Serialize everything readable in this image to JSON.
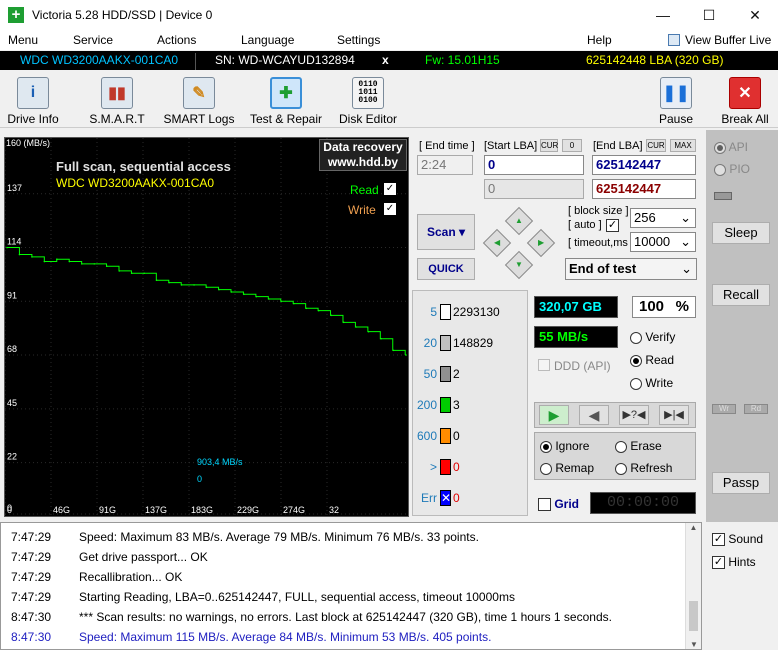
{
  "title": "Victoria 5.28 HDD/SSD | Device 0",
  "window_controls": {
    "minimize": "—",
    "maximize": "☐",
    "close": "✕"
  },
  "menu": [
    "Menu",
    "Service",
    "Actions",
    "Language",
    "Settings",
    "Help"
  ],
  "view_buffer": "View Buffer Live",
  "info": {
    "model": "WDC WD3200AAKX-001CA0",
    "serial": "SN: WD-WCAYUD132894",
    "close": "x",
    "fw": "Fw: 15.01H15",
    "lba": "625142448 LBA (320 GB)"
  },
  "toolbar": {
    "drive_info": "Drive Info",
    "smart": "S.M.A.R.T",
    "smart_logs": "SMART Logs",
    "test_repair": "Test & Repair",
    "disk_editor": "Disk Editor",
    "pause": "Pause",
    "break_all": "Break All"
  },
  "graph": {
    "ylabel": "160 (MB/s)",
    "yticks": [
      "137",
      "114",
      "91",
      "68",
      "45",
      "22",
      "0"
    ],
    "xticks": [
      "0",
      "46G",
      "91G",
      "137G",
      "183G",
      "229G",
      "274G",
      "32"
    ],
    "title": "Full scan, sequential access",
    "model": "WDC WD3200AAKX-001CA0",
    "read": "Read",
    "write": "Write",
    "speed_label": "903,4 MB/s",
    "speed_zero": "0",
    "dr_line1": "Data recovery",
    "dr_line2": "www.hdd.by"
  },
  "chart_data": {
    "type": "line",
    "ylabel": "(MB/s)",
    "ylim": [
      0,
      160
    ],
    "xtick_labels": [
      "0",
      "46G",
      "91G",
      "137G",
      "183G",
      "229G",
      "274G",
      "32"
    ],
    "series": [
      {
        "name": "Read",
        "x": [
          0,
          10,
          20,
          30,
          40,
          50,
          60,
          70,
          80,
          90,
          100,
          110,
          120,
          130,
          140,
          150,
          160,
          170,
          180,
          190,
          200,
          210,
          220,
          230,
          240,
          250,
          260,
          270,
          280,
          290,
          300,
          310,
          320
        ],
        "values": [
          114,
          111,
          110,
          108,
          109,
          108,
          107,
          107,
          106,
          104,
          103,
          103,
          100,
          99,
          98,
          98,
          97,
          96,
          95,
          94,
          93,
          92,
          91,
          90,
          88,
          87,
          85,
          82,
          80,
          78,
          75,
          70,
          68
        ]
      }
    ]
  },
  "ctrl": {
    "end_time_label": "[ End time ]",
    "end_time": "2:24",
    "start_lba_label": "[Start LBA]",
    "cur": "CUR",
    "zero_btn": "0",
    "end_lba_label": "[End LBA]",
    "max": "MAX",
    "start_lba": "0",
    "end_lba": "625142447",
    "cur_lba": "0",
    "cur_end": "625142447",
    "scan": "Scan",
    "quick": "QUICK",
    "block_size_label": "[ block size ]",
    "auto_label": "[ auto ]",
    "block_size": "256",
    "timeout_label": "[ timeout,ms ]",
    "timeout": "10000",
    "end_of_test": "End of test"
  },
  "counts": [
    {
      "label": "5",
      "value": "2293130",
      "color": "#ffffff"
    },
    {
      "label": "20",
      "value": "148829",
      "color": "#c0c0c0"
    },
    {
      "label": "50",
      "value": "2",
      "color": "#909090"
    },
    {
      "label": "200",
      "value": "3",
      "color": "#00cc00"
    },
    {
      "label": "600",
      "value": "0",
      "color": "#ff8c00"
    },
    {
      "label": ">",
      "value": "0",
      "color": "#ff0000"
    },
    {
      "label": "Err",
      "value": "0",
      "color": "#0000ff"
    }
  ],
  "stats": {
    "size": "320,07 GB",
    "percent": "100",
    "pct_sign": "%",
    "speed": "55 MB/s",
    "ddd": "DDD (API)"
  },
  "mode": {
    "verify": "Verify",
    "read": "Read",
    "write": "Write"
  },
  "repair": {
    "ignore": "Ignore",
    "erase": "Erase",
    "remap": "Remap",
    "refresh": "Refresh"
  },
  "grid": {
    "label": "Grid",
    "timer": "00:00:00"
  },
  "side": {
    "api": "API",
    "pio": "PIO",
    "sleep": "Sleep",
    "recall": "Recall",
    "wr": "Wr",
    "rd": "Rd",
    "passp": "Passp",
    "sound": "Sound",
    "hints": "Hints"
  },
  "log": [
    {
      "time": "7:47:29",
      "msg": "Speed: Maximum 83 MB/s. Average 79 MB/s. Minimum 76 MB/s. 33 points.",
      "color": "#000000"
    },
    {
      "time": "7:47:29",
      "msg": "Get drive passport... OK",
      "color": "#000000"
    },
    {
      "time": "7:47:29",
      "msg": "Recallibration... OK",
      "color": "#000000"
    },
    {
      "time": "7:47:29",
      "msg": "Starting Reading, LBA=0..625142447, FULL, sequential access, timeout 10000ms",
      "color": "#000000"
    },
    {
      "time": "8:47:30",
      "msg": "*** Scan results: no warnings, no errors. Last block at 625142447 (320 GB), time 1 hours 1 seconds.",
      "color": "#000000"
    },
    {
      "time": "8:47:30",
      "msg": "Speed: Maximum 115 MB/s. Average 84 MB/s. Minimum 53 MB/s. 405 points.",
      "color": "#2020c0"
    }
  ]
}
